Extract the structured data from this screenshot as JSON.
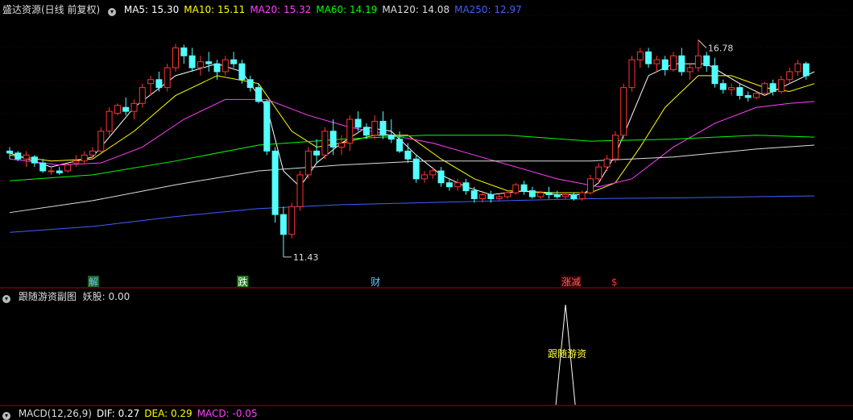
{
  "header": {
    "title": "盛达资源(日线 前复权)",
    "ma_items": [
      {
        "label": "MA5: 15.30",
        "color": "#ffffff"
      },
      {
        "label": "MA10: 15.11",
        "color": "#ffff00"
      },
      {
        "label": "MA20: 15.32",
        "color": "#ff40ff"
      },
      {
        "label": "MA60: 14.19",
        "color": "#00ff00"
      },
      {
        "label": "MA120: 14.08",
        "color": "#dddddd"
      },
      {
        "label": "MA250: 12.97",
        "color": "#4060ff"
      }
    ]
  },
  "sub_header": {
    "title": "跟随游资副图",
    "value_text": "妖股: 0.00"
  },
  "bottom_header": {
    "items": [
      {
        "label": "MACD(12,26,9)",
        "color": "#dddddd"
      },
      {
        "label": "DIF: 0.27",
        "color": "#ffffff"
      },
      {
        "label": "DEA: 0.29",
        "color": "#ffff00"
      },
      {
        "label": "MACD: -0.05",
        "color": "#ff40ff"
      }
    ]
  },
  "colors": {
    "up": "#ff3333",
    "down": "#54ffff",
    "axis": "#b00000",
    "ma5": "#ffffff",
    "ma10": "#ffff00",
    "ma20": "#ff40ff",
    "ma60": "#00ff00",
    "ma120": "#dddddd",
    "ma250": "#4060ff"
  },
  "chart_data": {
    "type": "candlestick",
    "max_label": "16.78",
    "min_label": "11.43",
    "price_range": [
      11.0,
      17.5
    ],
    "candles": [
      [
        14.1,
        14.2,
        13.9,
        14.05
      ],
      [
        14.05,
        14.1,
        13.85,
        13.9
      ],
      [
        13.9,
        14.1,
        13.7,
        14.0
      ],
      [
        13.95,
        14.0,
        13.7,
        13.8
      ],
      [
        13.8,
        13.9,
        13.55,
        13.6
      ],
      [
        13.6,
        13.7,
        13.5,
        13.6
      ],
      [
        13.6,
        13.7,
        13.5,
        13.55
      ],
      [
        13.6,
        13.8,
        13.55,
        13.75
      ],
      [
        13.8,
        14.0,
        13.7,
        13.85
      ],
      [
        13.85,
        14.1,
        13.8,
        14.0
      ],
      [
        14.0,
        14.2,
        13.9,
        14.1
      ],
      [
        14.1,
        14.7,
        14.05,
        14.6
      ],
      [
        14.6,
        15.2,
        14.5,
        15.1
      ],
      [
        15.05,
        15.3,
        15.0,
        15.25
      ],
      [
        15.2,
        15.45,
        15.0,
        15.1
      ],
      [
        15.1,
        15.4,
        14.9,
        15.3
      ],
      [
        15.3,
        15.8,
        15.2,
        15.7
      ],
      [
        15.8,
        16.0,
        15.5,
        15.9
      ],
      [
        15.9,
        16.1,
        15.6,
        15.7
      ],
      [
        15.7,
        16.3,
        15.6,
        16.2
      ],
      [
        16.2,
        16.8,
        16.1,
        16.7
      ],
      [
        16.7,
        16.78,
        16.3,
        16.5
      ],
      [
        16.5,
        16.7,
        16.1,
        16.2
      ],
      [
        16.2,
        16.5,
        16.0,
        16.35
      ],
      [
        16.35,
        16.6,
        16.1,
        16.3
      ],
      [
        16.3,
        16.4,
        15.9,
        16.1
      ],
      [
        16.1,
        16.5,
        16.0,
        16.4
      ],
      [
        16.4,
        16.6,
        16.2,
        16.3
      ],
      [
        16.3,
        16.4,
        15.8,
        15.9
      ],
      [
        15.9,
        16.0,
        15.6,
        15.7
      ],
      [
        15.7,
        15.8,
        15.3,
        15.35
      ],
      [
        15.35,
        15.4,
        14.0,
        14.1
      ],
      [
        14.1,
        14.2,
        12.3,
        12.5
      ],
      [
        12.5,
        12.7,
        11.43,
        12.0
      ],
      [
        12.0,
        12.8,
        11.9,
        12.7
      ],
      [
        12.7,
        13.6,
        12.6,
        13.5
      ],
      [
        13.5,
        14.2,
        13.4,
        14.1
      ],
      [
        14.1,
        14.4,
        13.8,
        14.0
      ],
      [
        14.0,
        14.7,
        13.9,
        14.6
      ],
      [
        14.6,
        14.9,
        14.0,
        14.2
      ],
      [
        14.2,
        14.5,
        14.0,
        14.3
      ],
      [
        14.3,
        15.0,
        14.1,
        14.9
      ],
      [
        14.9,
        15.1,
        14.6,
        14.7
      ],
      [
        14.7,
        14.8,
        14.4,
        14.5
      ],
      [
        14.5,
        15.0,
        14.4,
        14.85
      ],
      [
        14.85,
        15.1,
        14.4,
        14.5
      ],
      [
        14.5,
        14.9,
        14.3,
        14.4
      ],
      [
        14.4,
        14.6,
        14.05,
        14.1
      ],
      [
        14.1,
        14.3,
        13.8,
        13.9
      ],
      [
        13.9,
        14.0,
        13.3,
        13.4
      ],
      [
        13.4,
        13.6,
        13.3,
        13.5
      ],
      [
        13.5,
        13.7,
        13.4,
        13.6
      ],
      [
        13.6,
        13.7,
        13.2,
        13.3
      ],
      [
        13.3,
        13.4,
        13.1,
        13.2
      ],
      [
        13.2,
        13.4,
        13.1,
        13.3
      ],
      [
        13.3,
        13.4,
        13.0,
        13.1
      ],
      [
        13.1,
        13.2,
        12.8,
        12.9
      ],
      [
        12.9,
        13.1,
        12.8,
        13.0
      ],
      [
        13.0,
        13.1,
        12.8,
        12.9
      ],
      [
        12.9,
        13.0,
        12.85,
        12.95
      ],
      [
        12.95,
        13.1,
        12.9,
        13.05
      ],
      [
        13.05,
        13.3,
        13.0,
        13.25
      ],
      [
        13.25,
        13.35,
        13.0,
        13.1
      ],
      [
        13.1,
        13.2,
        12.9,
        12.95
      ],
      [
        12.95,
        13.1,
        12.9,
        13.05
      ],
      [
        13.05,
        13.2,
        12.9,
        13.0
      ],
      [
        13.0,
        13.1,
        12.9,
        12.95
      ],
      [
        12.95,
        13.05,
        12.9,
        13.0
      ],
      [
        13.0,
        13.05,
        12.85,
        12.9
      ],
      [
        12.9,
        13.1,
        12.85,
        13.05
      ],
      [
        13.05,
        13.5,
        13.0,
        13.4
      ],
      [
        13.4,
        13.8,
        13.3,
        13.7
      ],
      [
        13.7,
        14.0,
        13.6,
        13.9
      ],
      [
        13.9,
        14.6,
        13.8,
        14.5
      ],
      [
        14.5,
        15.8,
        14.4,
        15.7
      ],
      [
        15.7,
        16.5,
        15.6,
        16.4
      ],
      [
        16.4,
        16.7,
        16.2,
        16.6
      ],
      [
        16.6,
        16.7,
        16.2,
        16.3
      ],
      [
        16.3,
        16.5,
        16.1,
        16.4
      ],
      [
        16.4,
        16.5,
        16.0,
        16.15
      ],
      [
        16.15,
        16.6,
        16.1,
        16.5
      ],
      [
        16.5,
        16.7,
        16.0,
        16.1
      ],
      [
        16.1,
        16.3,
        15.9,
        16.2
      ],
      [
        16.2,
        16.9,
        16.1,
        16.5
      ],
      [
        16.5,
        16.6,
        16.1,
        16.25
      ],
      [
        16.25,
        16.45,
        15.7,
        15.8
      ],
      [
        15.8,
        15.9,
        15.55,
        15.65
      ],
      [
        15.65,
        15.8,
        15.5,
        15.7
      ],
      [
        15.7,
        15.8,
        15.4,
        15.5
      ],
      [
        15.5,
        15.6,
        15.35,
        15.45
      ],
      [
        15.45,
        15.6,
        15.4,
        15.55
      ],
      [
        15.55,
        15.85,
        15.5,
        15.8
      ],
      [
        15.8,
        15.9,
        15.5,
        15.6
      ],
      [
        15.6,
        16.0,
        15.55,
        15.9
      ],
      [
        15.9,
        16.2,
        15.8,
        16.1
      ],
      [
        16.1,
        16.4,
        16.0,
        16.3
      ],
      [
        16.3,
        16.35,
        15.9,
        16.0
      ]
    ],
    "ma_series": {
      "ma5": [
        [
          0,
          14.05
        ],
        [
          5,
          13.7
        ],
        [
          10,
          13.95
        ],
        [
          15,
          15.2
        ],
        [
          20,
          16.0
        ],
        [
          25,
          16.3
        ],
        [
          28,
          16.1
        ],
        [
          31,
          15.2
        ],
        [
          33,
          13.6
        ],
        [
          35,
          13.2
        ],
        [
          37,
          13.8
        ],
        [
          40,
          14.3
        ],
        [
          43,
          14.7
        ],
        [
          46,
          14.6
        ],
        [
          49,
          14.0
        ],
        [
          52,
          13.5
        ],
        [
          55,
          13.2
        ],
        [
          58,
          13.0
        ],
        [
          62,
          13.1
        ],
        [
          66,
          13.0
        ],
        [
          69,
          13.0
        ],
        [
          71,
          13.3
        ],
        [
          73,
          14.0
        ],
        [
          75,
          15.0
        ],
        [
          77,
          16.0
        ],
        [
          80,
          16.3
        ],
        [
          84,
          16.3
        ],
        [
          88,
          15.8
        ],
        [
          91,
          15.5
        ],
        [
          94,
          15.8
        ],
        [
          97,
          16.1
        ]
      ],
      "ma10": [
        [
          0,
          14.0
        ],
        [
          5,
          13.85
        ],
        [
          10,
          13.9
        ],
        [
          15,
          14.6
        ],
        [
          20,
          15.5
        ],
        [
          25,
          16.0
        ],
        [
          30,
          15.8
        ],
        [
          34,
          14.6
        ],
        [
          37,
          14.2
        ],
        [
          40,
          14.3
        ],
        [
          44,
          14.5
        ],
        [
          48,
          14.5
        ],
        [
          52,
          13.9
        ],
        [
          56,
          13.4
        ],
        [
          60,
          13.1
        ],
        [
          66,
          13.05
        ],
        [
          70,
          13.05
        ],
        [
          73,
          13.3
        ],
        [
          76,
          14.2
        ],
        [
          79,
          15.2
        ],
        [
          83,
          16.0
        ],
        [
          87,
          16.0
        ],
        [
          91,
          15.7
        ],
        [
          94,
          15.6
        ],
        [
          97,
          15.8
        ]
      ],
      "ma20": [
        [
          0,
          13.9
        ],
        [
          6,
          13.75
        ],
        [
          11,
          13.8
        ],
        [
          16,
          14.2
        ],
        [
          21,
          14.9
        ],
        [
          26,
          15.4
        ],
        [
          31,
          15.4
        ],
        [
          36,
          15.0
        ],
        [
          41,
          14.7
        ],
        [
          46,
          14.5
        ],
        [
          51,
          14.3
        ],
        [
          56,
          14.0
        ],
        [
          61,
          13.7
        ],
        [
          66,
          13.4
        ],
        [
          71,
          13.2
        ],
        [
          75,
          13.4
        ],
        [
          80,
          14.2
        ],
        [
          85,
          14.8
        ],
        [
          90,
          15.2
        ],
        [
          94,
          15.3
        ],
        [
          97,
          15.35
        ]
      ],
      "ma60": [
        [
          0,
          13.35
        ],
        [
          10,
          13.5
        ],
        [
          20,
          13.85
        ],
        [
          30,
          14.25
        ],
        [
          40,
          14.4
        ],
        [
          50,
          14.5
        ],
        [
          60,
          14.5
        ],
        [
          70,
          14.35
        ],
        [
          80,
          14.4
        ],
        [
          90,
          14.5
        ],
        [
          97,
          14.45
        ]
      ],
      "ma120": [
        [
          0,
          12.55
        ],
        [
          10,
          12.85
        ],
        [
          20,
          13.25
        ],
        [
          30,
          13.6
        ],
        [
          40,
          13.75
        ],
        [
          50,
          13.85
        ],
        [
          60,
          13.85
        ],
        [
          70,
          13.85
        ],
        [
          80,
          13.95
        ],
        [
          90,
          14.15
        ],
        [
          97,
          14.25
        ]
      ],
      "ma250": [
        [
          0,
          12.05
        ],
        [
          10,
          12.2
        ],
        [
          20,
          12.45
        ],
        [
          30,
          12.65
        ],
        [
          40,
          12.75
        ],
        [
          50,
          12.8
        ],
        [
          60,
          12.85
        ],
        [
          70,
          12.9
        ],
        [
          80,
          12.92
        ],
        [
          90,
          12.95
        ],
        [
          97,
          12.97
        ]
      ]
    },
    "markers": [
      {
        "index": 10,
        "text": "解",
        "color": "#66ccff",
        "bg": "#206020"
      },
      {
        "index": 28,
        "text": "跌",
        "color": "#ffffff",
        "bg": "#208020"
      },
      {
        "index": 44,
        "text": "财",
        "color": "#66ccff",
        "bg": "#000000"
      },
      {
        "index": 67,
        "text": "涨减",
        "color": "#ff6060",
        "bg": "#300000"
      },
      {
        "index": 73,
        "text": "$",
        "color": "#ff3030",
        "bg": "#000000"
      }
    ],
    "sub_indicator": {
      "label": "跟随游资",
      "spike_index": 67,
      "spike_value": 1
    }
  }
}
